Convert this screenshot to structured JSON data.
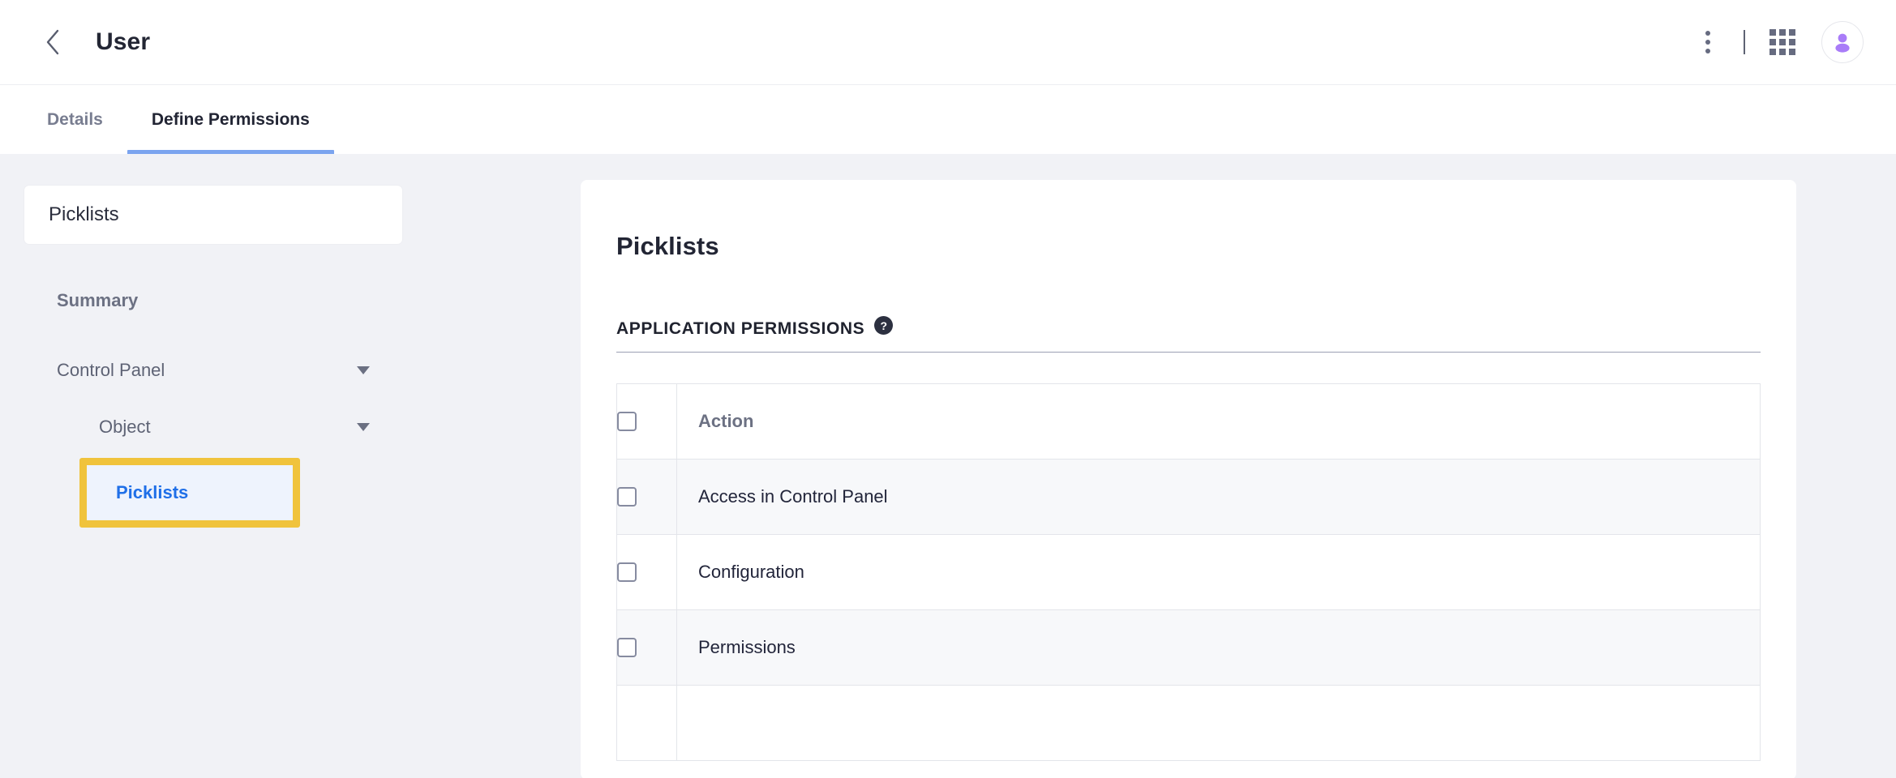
{
  "header": {
    "back_icon": "chevron-left-icon",
    "title": "User",
    "actions": {
      "kebab_icon": "more-vertical-icon",
      "apps_icon": "apps-grid-icon",
      "avatar_icon": "user-avatar-icon"
    }
  },
  "tabs": [
    {
      "label": "Details",
      "active": false
    },
    {
      "label": "Define Permissions",
      "active": true
    }
  ],
  "sidebar": {
    "search_value": "Picklists",
    "tree": [
      {
        "label": "Summary",
        "level": 0,
        "expandable": false,
        "selected": false
      },
      {
        "label": "Control Panel",
        "level": 0,
        "expandable": true,
        "selected": false
      },
      {
        "label": "Object",
        "level": 1,
        "expandable": true,
        "selected": false
      },
      {
        "label": "Picklists",
        "level": 2,
        "expandable": false,
        "selected": true
      }
    ]
  },
  "main": {
    "title": "Picklists",
    "section": {
      "label": "APPLICATION PERMISSIONS",
      "help_icon": "question-mark-icon",
      "help_glyph": "?"
    },
    "table": {
      "columns": [
        "",
        "Action"
      ],
      "header_checkbox_checked": false,
      "rows": [
        {
          "label": "Access in Control Panel",
          "checked": false
        },
        {
          "label": "Configuration",
          "checked": false
        },
        {
          "label": "Permissions",
          "checked": false
        },
        {
          "label": "",
          "checked": false
        }
      ]
    }
  },
  "colors": {
    "accent_blue": "#1f6fe8",
    "tab_underline": "#7ba4ef",
    "highlight_yellow": "#f0c33c",
    "selected_row_bg": "#eef3fd",
    "page_bg": "#f1f2f6",
    "avatar_purple": "#a97cf8",
    "icon_gray": "#666b80",
    "help_dark": "#2c3040"
  }
}
